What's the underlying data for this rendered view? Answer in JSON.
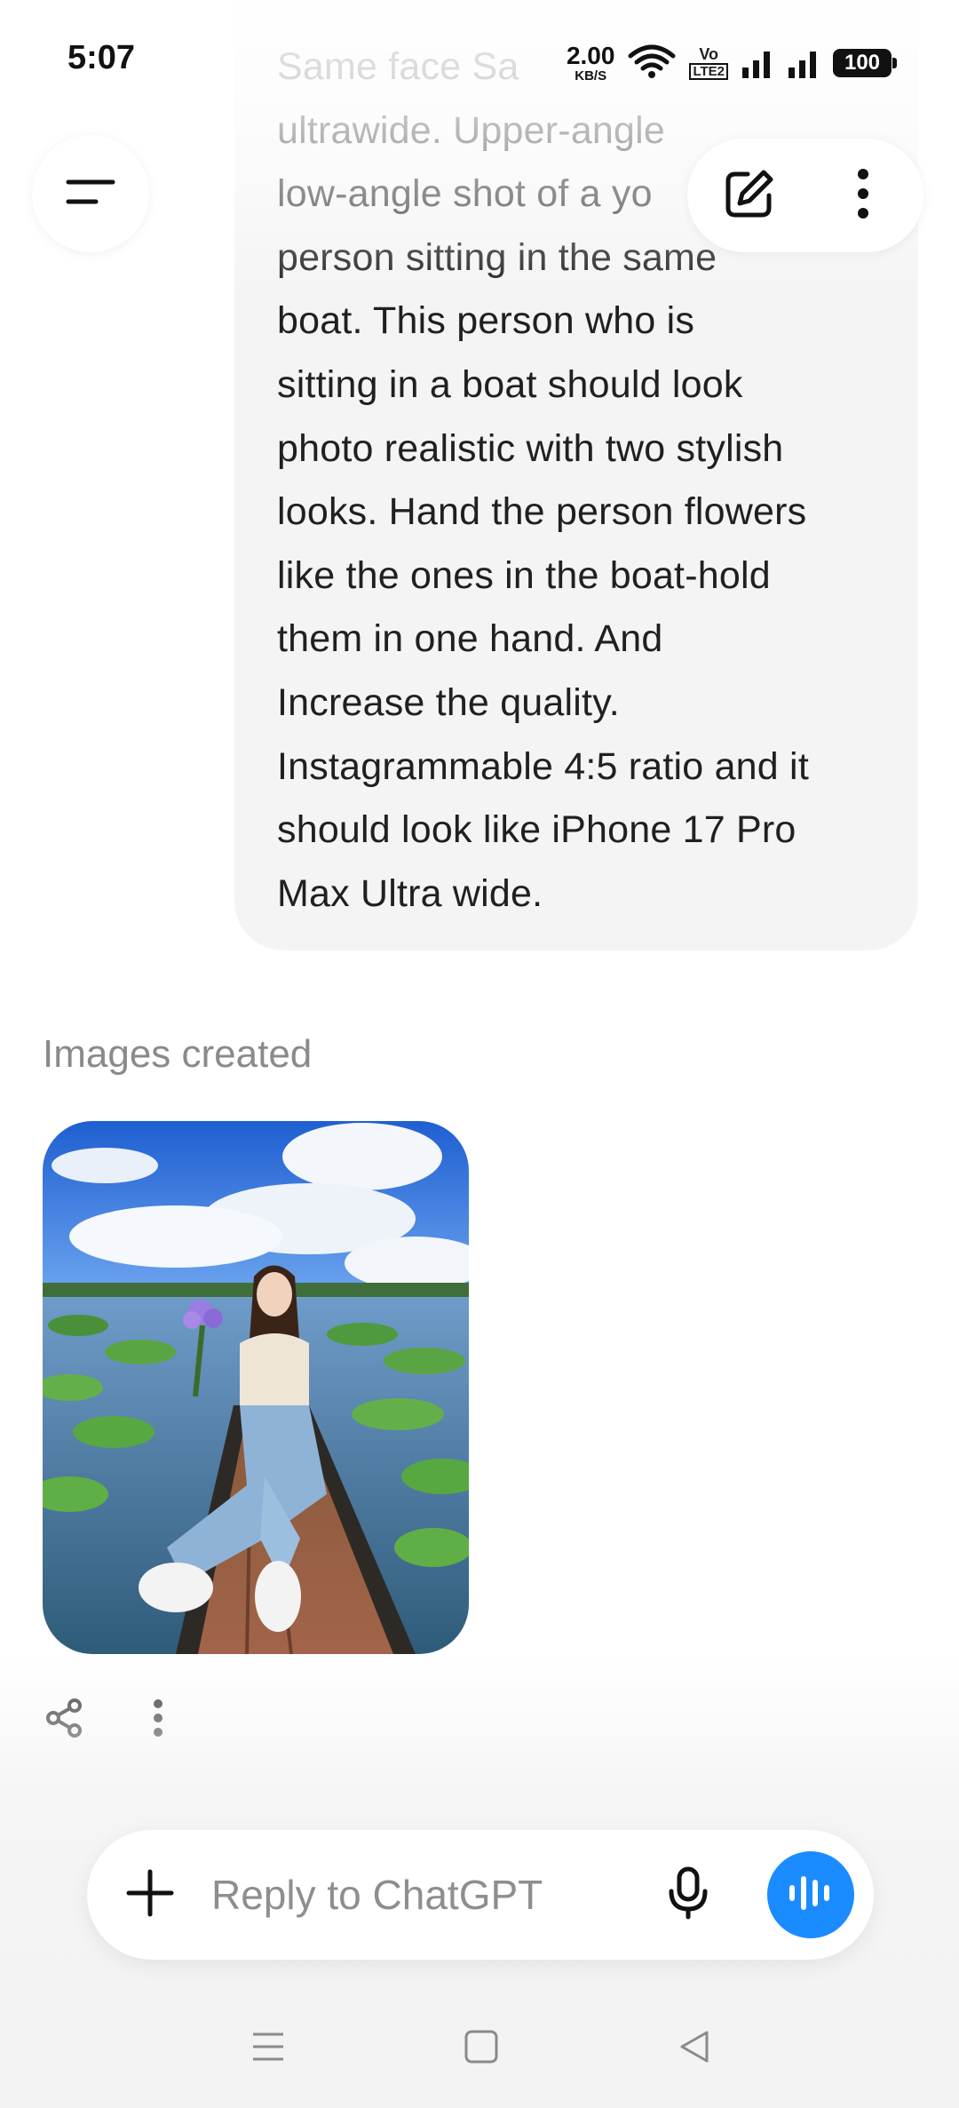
{
  "status_bar": {
    "time": "5:07",
    "net_speed_value": "2.00",
    "net_speed_unit": "KB/S",
    "volte_top": "Vo",
    "volte_bottom": "LTE2",
    "battery": "100"
  },
  "message": {
    "lines": [
      "Same face Sa",
      "ultrawide. Upper-angle",
      "low-angle shot of a yo",
      "person sitting in the same",
      "boat. This person who is",
      "sitting in a boat should look",
      "photo realistic with two stylish",
      "looks. Hand the person flowers",
      "like the ones in the boat-hold",
      "them in one hand. And",
      "Increase the quality.",
      "Instagrammable 4:5 ratio and it",
      "should look like iPhone 17 Pro",
      "Max Ultra wide."
    ]
  },
  "response": {
    "label": "Images created"
  },
  "composer": {
    "placeholder": "Reply to ChatGPT"
  },
  "icons": {
    "menu": "menu-icon",
    "edit": "edit-icon",
    "more": "more-vertical-icon",
    "share": "share-icon",
    "plus": "plus-icon",
    "mic": "mic-icon",
    "voice": "voice-waveform-icon",
    "nav_recents": "recents-icon",
    "nav_home": "home-icon",
    "nav_back": "back-icon"
  },
  "colors": {
    "accent": "#1a8cff",
    "bubble": "#f4f4f4",
    "muted_text": "#8a8a8a"
  }
}
